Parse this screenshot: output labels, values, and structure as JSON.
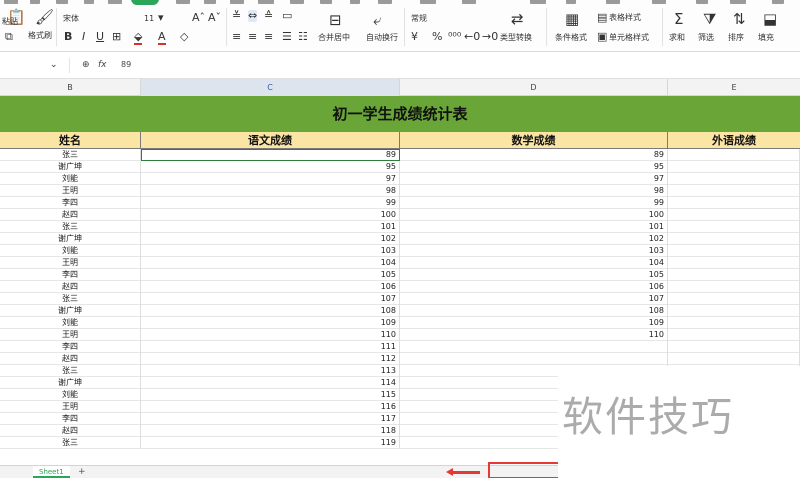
{
  "ribbon": {
    "paste_label": "粘贴",
    "format_painter_label": "格式刷",
    "font_name": "宋体",
    "font_size": "11",
    "merge_label": "合并居中",
    "wrap_label": "自动换行",
    "number_format": "常规",
    "convert_label": "类型转换",
    "conditional_label": "条件格式",
    "table_style_label": "表格样式",
    "cell_style_label": "单元格样式",
    "sum_label": "求和",
    "filter_label": "筛选",
    "sort_label": "排序",
    "fill_label": "填充"
  },
  "formula_bar": {
    "fx_label": "fx",
    "value": "89"
  },
  "columns": [
    "B",
    "C",
    "D",
    "E"
  ],
  "sheet": {
    "title": "初一学生成绩统计表",
    "headers": [
      "姓名",
      "语文成绩",
      "数学成绩",
      "外语成绩"
    ],
    "rows": [
      {
        "name": "张三",
        "chinese": "89",
        "math": "89"
      },
      {
        "name": "谢广坤",
        "chinese": "95",
        "math": "95"
      },
      {
        "name": "刘能",
        "chinese": "97",
        "math": "97"
      },
      {
        "name": "王明",
        "chinese": "98",
        "math": "98"
      },
      {
        "name": "李四",
        "chinese": "99",
        "math": "99"
      },
      {
        "name": "赵四",
        "chinese": "100",
        "math": "100"
      },
      {
        "name": "张三",
        "chinese": "101",
        "math": "101"
      },
      {
        "name": "谢广坤",
        "chinese": "102",
        "math": "102"
      },
      {
        "name": "刘能",
        "chinese": "103",
        "math": "103"
      },
      {
        "name": "王明",
        "chinese": "104",
        "math": "104"
      },
      {
        "name": "李四",
        "chinese": "105",
        "math": "105"
      },
      {
        "name": "赵四",
        "chinese": "106",
        "math": "106"
      },
      {
        "name": "张三",
        "chinese": "107",
        "math": "107"
      },
      {
        "name": "谢广坤",
        "chinese": "108",
        "math": "108"
      },
      {
        "name": "刘能",
        "chinese": "109",
        "math": "109"
      },
      {
        "name": "王明",
        "chinese": "110",
        "math": "110"
      },
      {
        "name": "李四",
        "chinese": "111",
        "math": ""
      },
      {
        "name": "赵四",
        "chinese": "112",
        "math": ""
      },
      {
        "name": "张三",
        "chinese": "113",
        "math": ""
      },
      {
        "name": "谢广坤",
        "chinese": "114",
        "math": ""
      },
      {
        "name": "刘能",
        "chinese": "115",
        "math": ""
      },
      {
        "name": "王明",
        "chinese": "116",
        "math": ""
      },
      {
        "name": "李四",
        "chinese": "117",
        "math": ""
      },
      {
        "name": "赵四",
        "chinese": "118",
        "math": ""
      },
      {
        "name": "张三",
        "chinese": "119",
        "math": ""
      }
    ]
  },
  "status": {
    "sheet_tab": "Sheet1",
    "add_sheet": "+"
  },
  "watermark": "软件技巧",
  "colors": {
    "title_fill": "#6aa637",
    "header_fill": "#fbe5a5",
    "accent": "#2aa55a",
    "annotation": "#e53935"
  }
}
